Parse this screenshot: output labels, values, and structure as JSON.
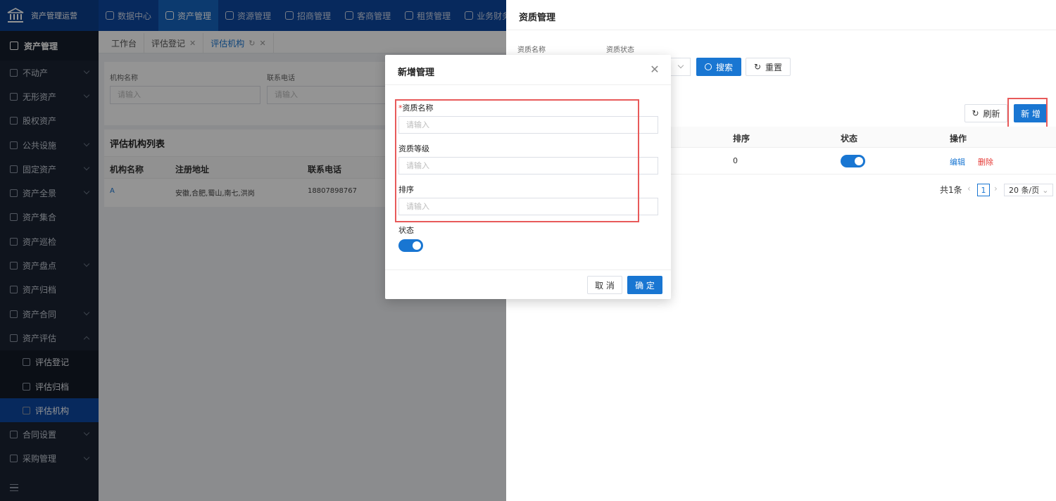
{
  "app": {
    "title": "资产管理运营"
  },
  "topnav": [
    {
      "label": "数据中心",
      "active": false
    },
    {
      "label": "资产管理",
      "active": true
    },
    {
      "label": "资源管理",
      "active": false
    },
    {
      "label": "招商管理",
      "active": false
    },
    {
      "label": "客商管理",
      "active": false
    },
    {
      "label": "租赁管理",
      "active": false
    },
    {
      "label": "业务财务",
      "active": false
    }
  ],
  "sidebar": {
    "header": "资产管理",
    "items": [
      {
        "label": "不动产",
        "chevron": "down"
      },
      {
        "label": "无形资产",
        "chevron": "down"
      },
      {
        "label": "股权资产",
        "chevron": ""
      },
      {
        "label": "公共设施",
        "chevron": "down"
      },
      {
        "label": "固定资产",
        "chevron": "down"
      },
      {
        "label": "资产全景",
        "chevron": "down"
      },
      {
        "label": "资产集合",
        "chevron": ""
      },
      {
        "label": "资产巡检",
        "chevron": ""
      },
      {
        "label": "资产盘点",
        "chevron": "down"
      },
      {
        "label": "资产归档",
        "chevron": ""
      },
      {
        "label": "资产合同",
        "chevron": "down"
      },
      {
        "label": "资产评估",
        "chevron": "up"
      }
    ],
    "subitems": [
      {
        "label": "评估登记",
        "active": false
      },
      {
        "label": "评估归档",
        "active": false
      },
      {
        "label": "评估机构",
        "active": true
      }
    ],
    "items_after": [
      {
        "label": "合同设置",
        "chevron": "down"
      },
      {
        "label": "采购管理",
        "chevron": "down"
      }
    ]
  },
  "tabs": [
    {
      "label": "工作台",
      "closable": false,
      "active": false
    },
    {
      "label": "评估登记",
      "closable": true,
      "active": false
    },
    {
      "label": "评估机构",
      "closable": true,
      "active": true
    }
  ],
  "filter": {
    "org_name_label": "机构名称",
    "org_name_placeholder": "请输入",
    "phone_label": "联系电话",
    "phone_placeholder": "请输入"
  },
  "list": {
    "title": "评估机构列表",
    "columns": [
      "机构名称",
      "注册地址",
      "联系电话"
    ],
    "rows": [
      {
        "name": "A",
        "address": "安徽,合肥,蜀山,南七,洪岗",
        "phone": "18807898767"
      }
    ]
  },
  "drawer": {
    "title": "资质管理",
    "name_label": "资质名称",
    "status_label": "资质状态",
    "search_btn": "搜索",
    "reset_btn": "重置",
    "refresh_btn": "刷新",
    "add_btn": "新 增",
    "columns": [
      "排序",
      "状态",
      "操作"
    ],
    "rows": [
      {
        "sort": "0",
        "status_on": true,
        "edit": "编辑",
        "delete": "删除"
      }
    ],
    "pager": {
      "total": "共1条",
      "page": "1",
      "size": "20 条/页"
    }
  },
  "dialog": {
    "title": "新增管理",
    "required_mark": "*",
    "fields": [
      {
        "label": "资质名称",
        "placeholder": "请输入",
        "required": true
      },
      {
        "label": "资质等级",
        "placeholder": "请输入",
        "required": false
      },
      {
        "label": "排序",
        "placeholder": "请输入",
        "required": false
      }
    ],
    "status_label": "状态",
    "status_on": true,
    "cancel_btn": "取 消",
    "ok_btn": "确 定"
  },
  "colors": {
    "primary": "#1976d2",
    "topbar": "#0d47a1",
    "sidebar": "#1b2433",
    "danger": "#e53935",
    "highlight": "#e85a5a"
  }
}
